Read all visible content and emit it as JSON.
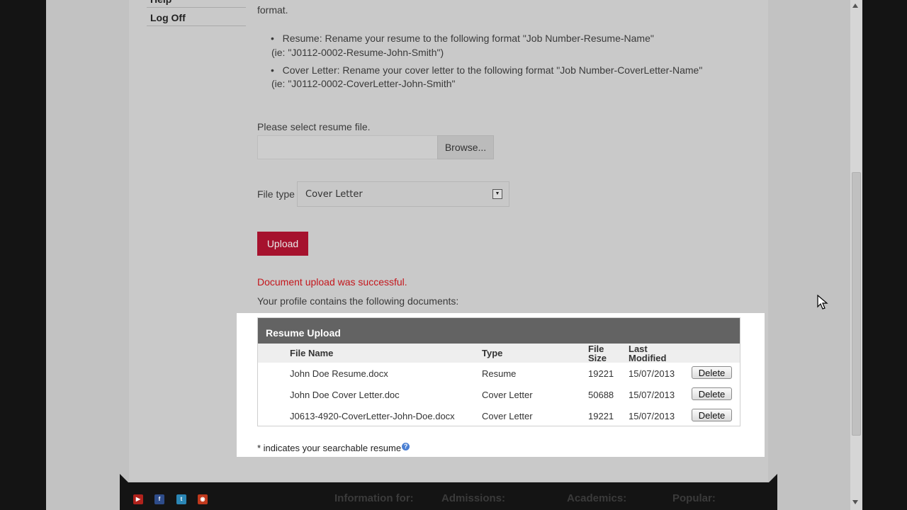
{
  "nav": {
    "help_label": "Help",
    "logoff_label": "Log Off"
  },
  "instructions": {
    "format_tail": "format.",
    "resume_bullet": "Resume: Rename your resume to the following format \"Job Number-Resume-Name\"",
    "resume_example": "(ie: \"J0112-0002-Resume-John-Smith\")",
    "cover_bullet": "Cover Letter: Rename your cover letter to the following format \"Job Number-CoverLetter-Name\"",
    "cover_example": "(ie: \"J0112-0002-CoverLetter-John-Smith\""
  },
  "file_select": {
    "label": "Please select resume file.",
    "browse_label": "Browse...",
    "value": ""
  },
  "file_type": {
    "label": "File type",
    "selected": "Cover Letter"
  },
  "upload_label": "Upload",
  "status": {
    "success_message": "Document upload was successful.",
    "profile_text": "Your profile contains the following documents:"
  },
  "resume_table": {
    "title": "Resume Upload",
    "columns": {
      "file_name": "File Name",
      "type": "Type",
      "file_size_1": "File",
      "file_size_2": "Size",
      "modified_1": "Last",
      "modified_2": "Modified"
    },
    "rows": [
      {
        "file_name": "John Doe Resume.docx",
        "type": "Resume",
        "size": "19221",
        "modified": "15/07/2013",
        "action": "Delete"
      },
      {
        "file_name": "John Doe Cover Letter.doc",
        "type": "Cover Letter",
        "size": "50688",
        "modified": "15/07/2013",
        "action": "Delete"
      },
      {
        "file_name": "J0613-4920-CoverLetter-John-Doe.docx",
        "type": "Cover Letter",
        "size": "19221",
        "modified": "15/07/2013",
        "action": "Delete"
      }
    ]
  },
  "footnote": "* indicates your searchable resume",
  "footer": {
    "links": [
      "Information for:",
      "Admissions:",
      "Academics:",
      "Popular:"
    ],
    "social_icons": [
      "youtube-icon",
      "facebook-icon",
      "twitter-icon",
      "rss-icon"
    ]
  },
  "colors": {
    "upload_button": "#a6122e",
    "success_text": "#c4161c",
    "table_header": "#636363"
  }
}
